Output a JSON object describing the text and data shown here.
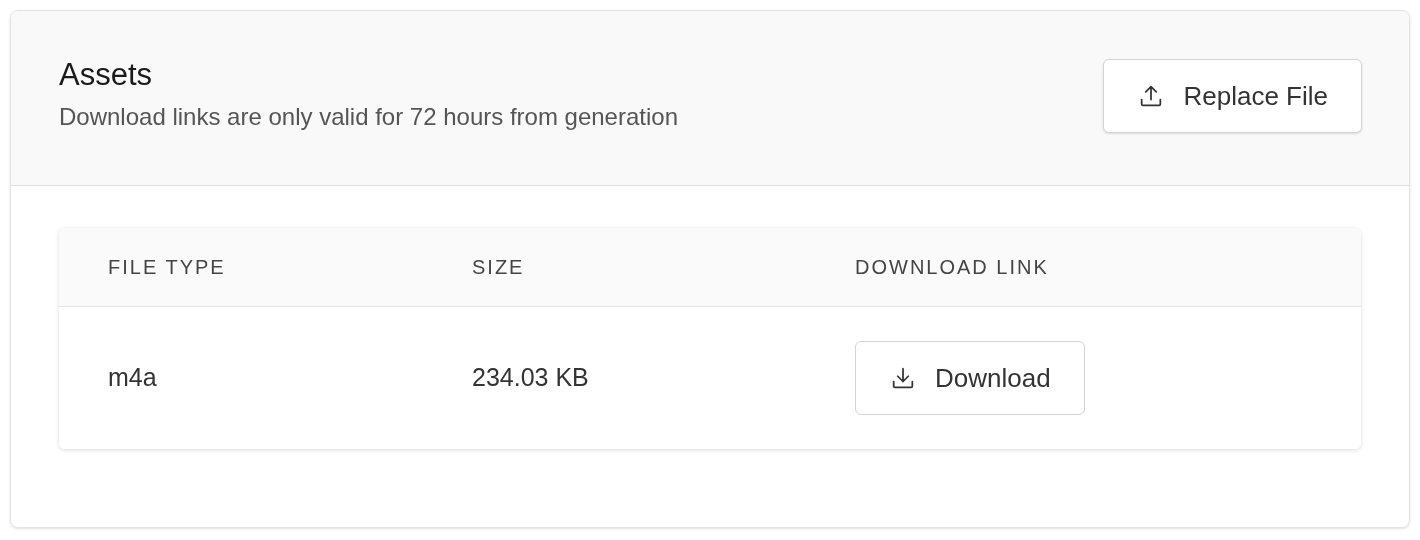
{
  "header": {
    "title": "Assets",
    "subtitle": "Download links are only valid for 72 hours from generation",
    "button": "Replace File"
  },
  "table": {
    "columns": [
      "FILE TYPE",
      "SIZE",
      "DOWNLOAD LINK"
    ],
    "rows": [
      {
        "file_type": "m4a",
        "size": "234.03 KB",
        "link": "Download"
      }
    ]
  }
}
